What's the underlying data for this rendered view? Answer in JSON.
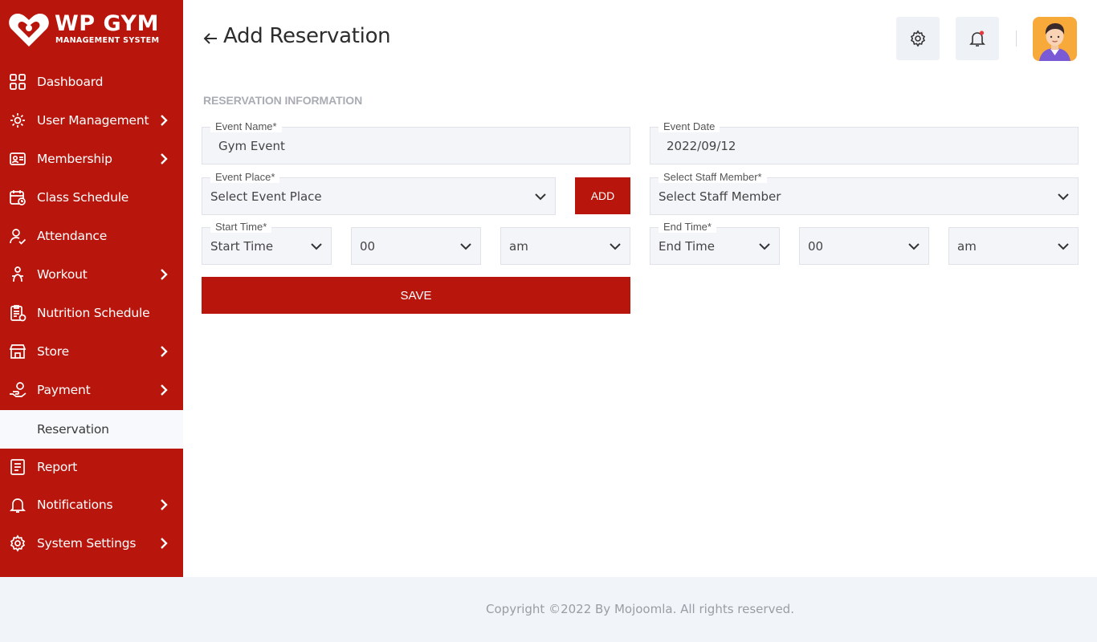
{
  "brand": {
    "title": "WP GYM",
    "subtitle": "MANAGEMENT SYSTEM",
    "color": "#b8160d"
  },
  "sidebar": {
    "items": [
      {
        "label": "Dashboard",
        "icon": "grid-icon",
        "has_submenu": false
      },
      {
        "label": "User Management",
        "icon": "users-gear-icon",
        "has_submenu": true
      },
      {
        "label": "Membership",
        "icon": "id-card-icon",
        "has_submenu": true
      },
      {
        "label": "Class Schedule",
        "icon": "calendar-icon",
        "has_submenu": false
      },
      {
        "label": "Attendance",
        "icon": "user-check-icon",
        "has_submenu": false
      },
      {
        "label": "Workout",
        "icon": "workout-icon",
        "has_submenu": true
      },
      {
        "label": "Nutrition Schedule",
        "icon": "clipboard-icon",
        "has_submenu": false
      },
      {
        "label": "Store",
        "icon": "store-icon",
        "has_submenu": true
      },
      {
        "label": "Payment",
        "icon": "payment-hand-icon",
        "has_submenu": true
      },
      {
        "label": "Reservation",
        "icon": "reservation-icon",
        "has_submenu": false,
        "active": true
      },
      {
        "label": "Report",
        "icon": "report-icon",
        "has_submenu": false
      },
      {
        "label": "Notifications",
        "icon": "bell-icon",
        "has_submenu": true
      },
      {
        "label": "System Settings",
        "icon": "gear-icon",
        "has_submenu": true
      }
    ]
  },
  "header": {
    "title": "Add Reservation"
  },
  "form": {
    "section_title": "RESERVATION INFORMATION",
    "event_name": {
      "label": "Event Name*",
      "value": "Gym Event"
    },
    "event_date": {
      "label": "Event Date",
      "value": "2022/09/12"
    },
    "event_place": {
      "label": "Event Place*",
      "value": "Select Event Place"
    },
    "add_label": "ADD",
    "staff": {
      "label": "Select Staff Member*",
      "value": "Select Staff Member"
    },
    "start_time": {
      "label": "Start Time*",
      "hour": "Start Time",
      "minute": "00",
      "ampm": "am"
    },
    "end_time": {
      "label": "End Time*",
      "hour": "End Time",
      "minute": "00",
      "ampm": "am"
    },
    "save_label": "SAVE"
  },
  "footer": {
    "text": "Copyright ©2022 By Mojoomla. All rights reserved."
  }
}
